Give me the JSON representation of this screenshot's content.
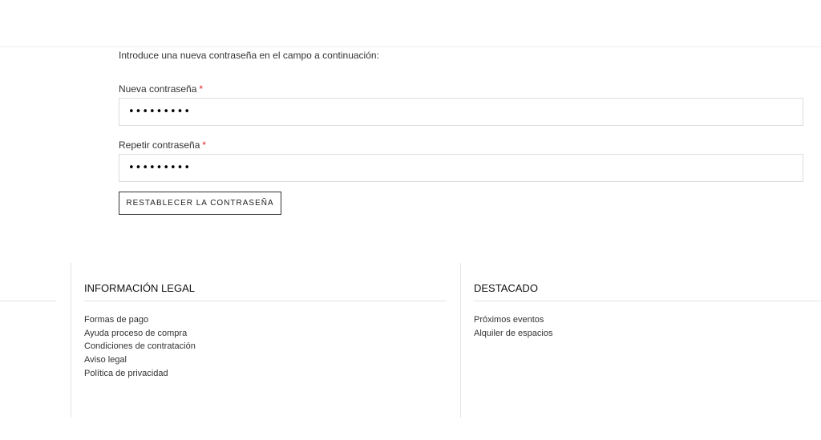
{
  "form": {
    "intro": "Introduce una nueva contraseña en el campo a continuación:",
    "new_password": {
      "label": "Nueva contraseña",
      "required_mark": "*",
      "value": "•••••••••"
    },
    "repeat_password": {
      "label": "Repetir contraseña",
      "required_mark": "*",
      "value": "•••••••••"
    },
    "submit_label": "RESTABLECER LA CONTRASEÑA"
  },
  "footer": {
    "legal": {
      "title": "INFORMACIÓN LEGAL",
      "links": [
        "Formas de pago",
        "Ayuda proceso de compra",
        "Condiciones de contratación",
        "Aviso legal",
        "Política de privacidad"
      ]
    },
    "featured": {
      "title": "DESTACADO",
      "links": [
        "Próximos eventos",
        "Alquiler de espacios"
      ]
    }
  }
}
